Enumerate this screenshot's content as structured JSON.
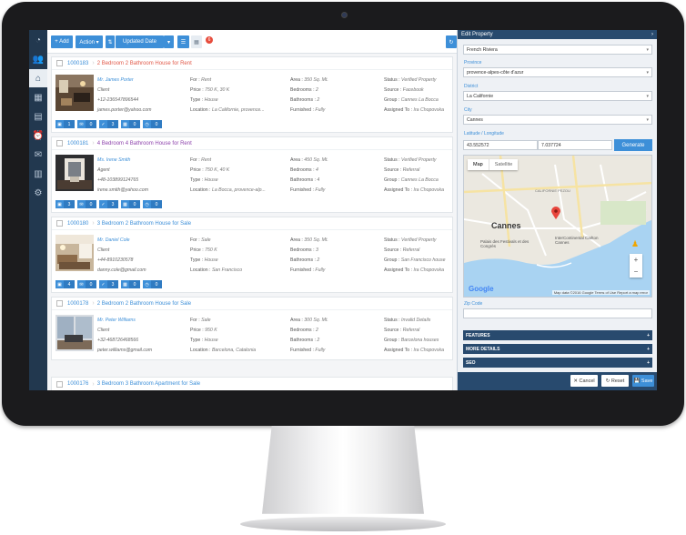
{
  "toolbar": {
    "add_label": "+ Add",
    "action_label": "Action ▾",
    "sort_label": "Updated Date",
    "badge_count": "6"
  },
  "properties": [
    {
      "id": "1000183",
      "title": "2 Bedroom 2 Bathroom House for Rent",
      "agent": "Mr. James Porter",
      "role": "Client",
      "phone": "+12-236547896544",
      "email": "james.porter@yahoo.com",
      "for": "Rent",
      "price": "750 K, 30 K",
      "type": "House",
      "location": "La Californie, provence...",
      "area": "350 Sq. Mt.",
      "bedrooms": "2",
      "bathrooms": "2",
      "furnished": "Fully",
      "status": "Verified Property",
      "source": "Facebook",
      "group": "Cannes La Bocca",
      "assigned": "Ira Chopovska",
      "chips": [
        "1",
        "0",
        "3",
        "0",
        "0"
      ]
    },
    {
      "id": "1000181",
      "title": "4 Bedroom 4 Bathroom House for Rent",
      "agent": "Ms. Irene Smith",
      "role": "Agent",
      "phone": "+48-103899124765",
      "email": "irene.smith@yahoo.com",
      "for": "Rent",
      "price": "750 K, 40 K",
      "type": "House",
      "location": "La Bocca, provence-alp...",
      "area": "450 Sq. Mt.",
      "bedrooms": "4",
      "bathrooms": "4",
      "furnished": "Fully",
      "status": "Verified Property",
      "source": "Referral",
      "group": "Cannes La Bocca",
      "assigned": "Ira Chopovska",
      "chips": [
        "3",
        "0",
        "3",
        "0",
        "0"
      ]
    },
    {
      "id": "1000180",
      "title": "3 Bedroom 2 Bathroom House for Sale",
      "agent": "Mr. Daniel Cole",
      "role": "Client",
      "phone": "+44-8910230578",
      "email": "danny.cole@gmail.com",
      "for": "Sale",
      "price": "750 K",
      "type": "House",
      "location": "San Francisco",
      "area": "350 Sq. Mt.",
      "bedrooms": "3",
      "bathrooms": "2",
      "furnished": "Fully",
      "status": "Verified Property",
      "source": "Referral",
      "group": "San Francisco house",
      "assigned": "Ira Chopovska",
      "chips": [
        "4",
        "0",
        "3",
        "0",
        "0"
      ]
    },
    {
      "id": "1000178",
      "title": "2 Bedroom 2 Bathroom House for Sale",
      "agent": "Mr. Peter Williams",
      "role": "Client",
      "phone": "+32-468726468566",
      "email": "peter.williams@gmail.com",
      "for": "Sale",
      "price": "950 K",
      "type": "House",
      "location": "Barcelona, Catalonia",
      "area": "300 Sq. Mt.",
      "bedrooms": "2",
      "bathrooms": "2",
      "furnished": "Fully",
      "status": "Invalid Details",
      "source": "Referral",
      "group": "Barcelona houses",
      "assigned": "Ira Chopovska",
      "chips": []
    }
  ],
  "next_property": {
    "id": "1000176",
    "title": "3 Bedroom 3 Bathroom Apartment for Sale"
  },
  "labels": {
    "for": "For :",
    "price": "Price :",
    "type": "Type :",
    "location": "Location :",
    "area": "Area :",
    "bedrooms": "Bedrooms :",
    "bathrooms": "Bathrooms :",
    "furnished": "Furnished :",
    "status": "Status :",
    "source": "Source :",
    "group": "Group :",
    "assigned": "Assigned To :"
  },
  "panel": {
    "title": "Edit Property",
    "region": "French Riviera",
    "province_label": "Province",
    "province": "provence-alpes-côte d'azur",
    "district_label": "District",
    "district": "La Californie",
    "city_label": "City",
    "city": "Cannes",
    "latlng_label": "Latitude / Longitude",
    "lat": "43.552572",
    "lng": "7.037724",
    "generate_label": "Generate",
    "map_tab": "Map",
    "satellite_tab": "Satellite",
    "map_city": "Cannes",
    "map_place1": "Palais des Festivals et des Congrès",
    "map_place2": "InterContinental Carlton Cannes",
    "map_place3": "CALIFORNIE PEZOU",
    "map_footer": "Map data ©2016 Google   Terms of Use   Report a map error",
    "google": "Google",
    "zip_label": "Zip Code",
    "features": "FEATURES",
    "more_details": "MORE DETAILS",
    "seo": "SEO",
    "cancel": "✕ Cancel",
    "reset": "↻ Reset",
    "save": "💾 Save"
  }
}
